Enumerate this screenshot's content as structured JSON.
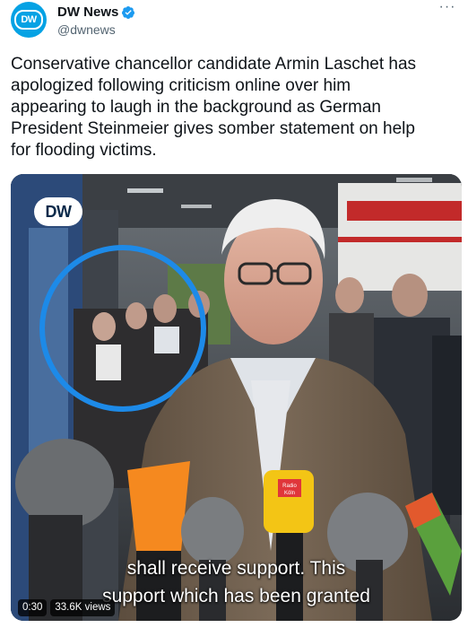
{
  "tweet": {
    "author": {
      "name": "DW News",
      "handle": "@dwnews",
      "avatar_text": "DW",
      "verified": true
    },
    "more_icon": "more-icon",
    "text_lines": [
      "Conservative chancellor candidate Armin Laschet has",
      "apologized following criticism online over him",
      "appearing to laugh in the background as German",
      "President Steinmeier gives somber statement on help",
      "for flooding victims."
    ],
    "media": {
      "logo_text": "DW",
      "subtitle_line1": "shall receive support. This",
      "subtitle_line2": "support which has been granted",
      "duration": "0:30",
      "views": "33.6K views",
      "circle_color": "#1d8ae8",
      "mic_labels": {
        "radio_koln_line1": "Radio",
        "radio_koln_line2": "Köln"
      }
    }
  },
  "colors": {
    "brand": "#05a2e4",
    "verified": "#1d9bf0",
    "text": "#0f1419",
    "secondary": "#536471"
  }
}
